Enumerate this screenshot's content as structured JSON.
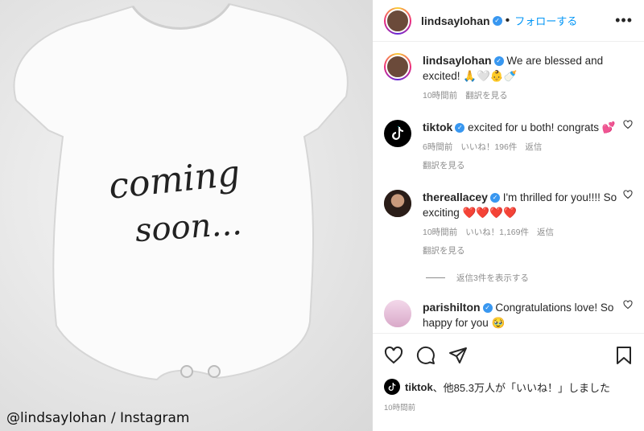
{
  "photo": {
    "onesie_text_line1": "coming",
    "onesie_text_line2": "soon...",
    "credit": "@lindsaylohan / Instagram"
  },
  "header": {
    "username": "lindsaylohan",
    "follow_label": "フォローする",
    "more": "•••"
  },
  "caption": {
    "username": "lindsaylohan",
    "text": "We are blessed and excited! 🙏🤍👶🍼",
    "time": "10時間前",
    "translate": "翻訳を見る"
  },
  "comments": [
    {
      "username": "tiktok",
      "text": "excited for u both! congrats 💕",
      "time": "6時間前",
      "likes": "いいね！196件",
      "reply": "返信",
      "translate": "翻訳を見る"
    },
    {
      "username": "thereallacey",
      "text": "I'm thrilled for you!!!! So exciting ❤️❤️❤️❤️",
      "time": "10時間前",
      "likes": "いいね！1,169件",
      "reply": "返信",
      "translate": "翻訳を見る"
    },
    {
      "username": "parishilton",
      "text": "Congratulations love! So happy for you 🥹"
    }
  ],
  "replies_label": "返信3件を表示する",
  "footer": {
    "liked_by_user": "tiktok",
    "liked_rest": "、他85.3万人が「いいね！」しました",
    "time": "10時間前"
  },
  "colors": {
    "accent": "#0095f6",
    "verified": "#3897f0",
    "muted": "#8e8e8e"
  }
}
